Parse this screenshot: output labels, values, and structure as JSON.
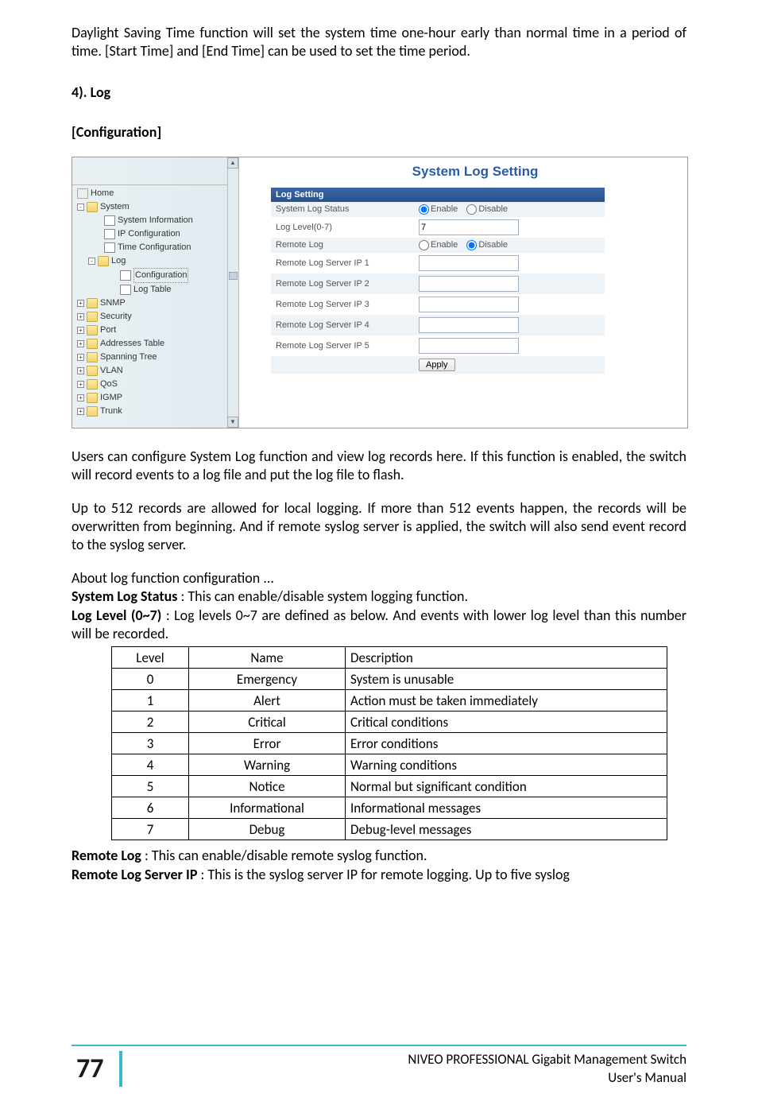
{
  "intro": {
    "dst_para": "Daylight Saving Time function will set the system time one-hour early than normal time in a period of time.  [Start Time] and [End Time] can be used to set the time period."
  },
  "section": {
    "log_title": "4). Log",
    "config_title": "[Configuration]"
  },
  "nav": {
    "home": "Home",
    "system": "System",
    "system_info": "System Information",
    "ip_config": "IP Configuration",
    "time_config": "Time Configuration",
    "log": "Log",
    "log_configuration": "Configuration",
    "log_table": "Log Table",
    "snmp": "SNMP",
    "security": "Security",
    "port": "Port",
    "addresses_table": "Addresses Table",
    "spanning_tree": "Spanning Tree",
    "vlan": "VLAN",
    "qos": "QoS",
    "igmp": "IGMP",
    "trunk": "Trunk"
  },
  "panel": {
    "title": "System Log Setting",
    "header": "Log Setting",
    "rows": {
      "sys_status": "System Log Status",
      "log_level": "Log Level(0-7)",
      "log_level_val": "7",
      "remote_log": "Remote Log",
      "ip1": "Remote Log Server IP 1",
      "ip2": "Remote Log Server IP 2",
      "ip3": "Remote Log Server IP 3",
      "ip4": "Remote Log Server IP 4",
      "ip5": "Remote Log Server IP 5"
    },
    "enable": "Enable",
    "disable": "Disable",
    "apply": "Apply"
  },
  "desc": {
    "para1": "Users can configure System Log function and view log records here.  If this function is enabled, the switch will record events to a log file and put the log file to flash.",
    "para2": "Up to 512 records are allowed for local logging.   If more than 512 events happen, the records will be overwritten from beginning.      And if remote syslog server is applied, the switch will also send event record to the syslog server.",
    "about": "About log function configuration ...",
    "sys_status_bold": "System Log Status",
    "sys_status_rest": " : This can enable/disable system logging function.",
    "loglevel_bold": "Log Level (0~7)",
    "loglevel_rest": " : Log levels 0~7 are defined as below.  And events with lower log level than this number will be recorded."
  },
  "remote": {
    "remote_log_bold": "Remote Log",
    "remote_log_rest": " : This can enable/disable remote syslog function.",
    "remote_ip_bold": "Remote Log Server IP",
    "remote_ip_rest": " : This is the syslog server IP for remote logging.  Up to five syslog"
  },
  "chart_data": {
    "type": "table",
    "columns": [
      "Level",
      "Name",
      "Description"
    ],
    "rows": [
      {
        "level": "0",
        "name": "Emergency",
        "description": "System is unusable"
      },
      {
        "level": "1",
        "name": "Alert",
        "description": "Action must be taken immediately"
      },
      {
        "level": "2",
        "name": "Critical",
        "description": "Critical conditions"
      },
      {
        "level": "3",
        "name": "Error",
        "description": "Error conditions"
      },
      {
        "level": "4",
        "name": "Warning",
        "description": "Warning conditions"
      },
      {
        "level": "5",
        "name": "Notice",
        "description": "Normal but significant condition"
      },
      {
        "level": "6",
        "name": "Informational",
        "description": "Informational messages"
      },
      {
        "level": "7",
        "name": "Debug",
        "description": "Debug-level messages"
      }
    ]
  },
  "footer": {
    "page": "77",
    "line1": "NIVEO PROFESSIONAL Gigabit Management Switch",
    "line2": "User's Manual"
  }
}
